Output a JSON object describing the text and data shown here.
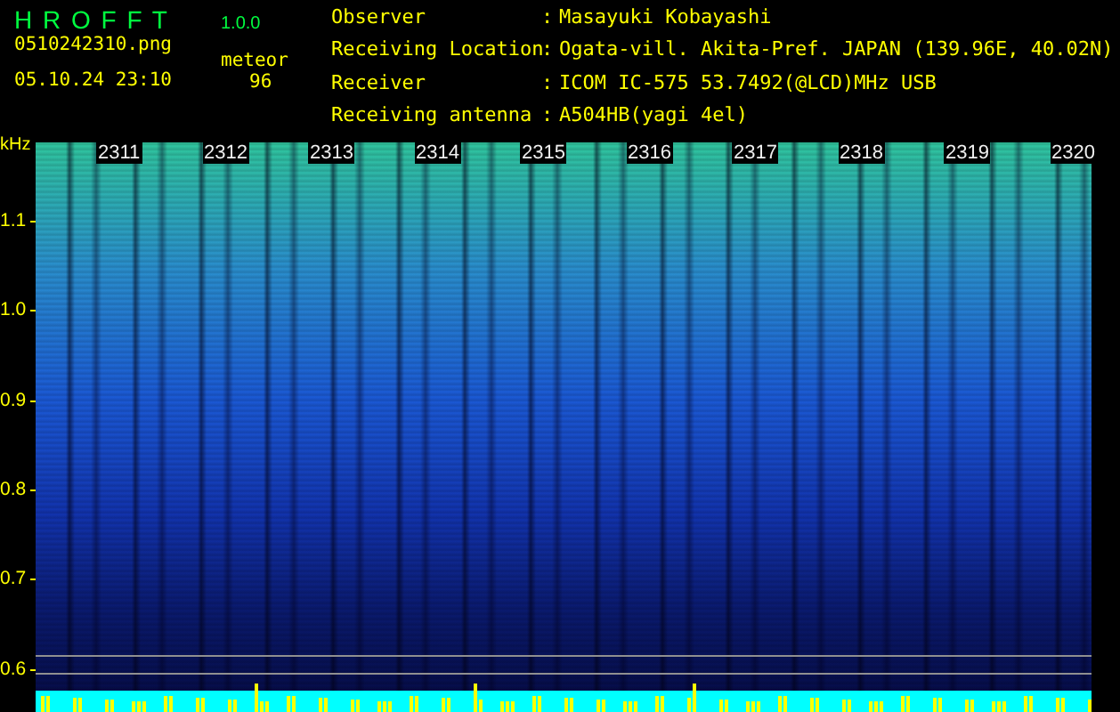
{
  "app": {
    "title": "H R O F F T",
    "version": "1.0.0",
    "filename": "0510242310.png",
    "datetime": "05.10.24 23:10",
    "count_label": "meteor",
    "count": "96"
  },
  "info": [
    {
      "label": "Observer",
      "separator": ":",
      "value": "Masayuki Kobayashi"
    },
    {
      "label": "Receiving Location",
      "separator": ":",
      "value": "Ogata-vill. Akita-Pref. JAPAN (139.96E, 40.02N)"
    },
    {
      "label": "Receiver",
      "separator": ":",
      "value": "ICOM IC-575 53.7492(@LCD)MHz USB"
    },
    {
      "label": "Receiving antenna",
      "separator": ":",
      "value": "A504HB(yagi 4el)"
    }
  ],
  "plot": {
    "unit": "kHz",
    "freq_labels": [
      "1.1",
      "1.0",
      "0.9",
      "0.8",
      "0.7",
      "0.6"
    ],
    "time_labels": [
      "2311",
      "2312",
      "2313",
      "2314",
      "2315",
      "2316",
      "2317",
      "2318",
      "2319",
      "2320"
    ]
  }
}
